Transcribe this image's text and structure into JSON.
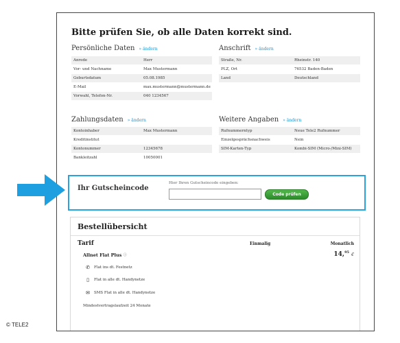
{
  "page_title": "Bitte prüfen Sie, ob alle Daten korrekt sind.",
  "edit_label": "» ändern",
  "personal": {
    "heading": "Persönliche Daten",
    "rows": [
      {
        "k": "Anrede",
        "v": "Herr"
      },
      {
        "k": "Vor- und Nachname",
        "v": "Max Mustermann"
      },
      {
        "k": "Geburtsdatum",
        "v": "05.08.1985"
      },
      {
        "k": "E-Mail",
        "v": "max.mustermann@mustermann.de"
      },
      {
        "k": "Vorwahl, Telefon-Nr.",
        "v": "040 1234567"
      }
    ]
  },
  "address": {
    "heading": "Anschrift",
    "rows": [
      {
        "k": "Straße, Nr.",
        "v": "Rheinstr. 140"
      },
      {
        "k": "PLZ, Ort",
        "v": "76532 Baden-Baden"
      },
      {
        "k": "Land",
        "v": "Deutschland"
      }
    ]
  },
  "payment": {
    "heading": "Zahlungsdaten",
    "rows": [
      {
        "k": "Kontoinhaber",
        "v": "Max Mustermann"
      },
      {
        "k": "Kreditinstitut",
        "v": ""
      },
      {
        "k": "Kontonummer",
        "v": "12345678"
      },
      {
        "k": "Bankleitzahl",
        "v": "10050001"
      }
    ]
  },
  "further": {
    "heading": "Weitere Angaben",
    "rows": [
      {
        "k": "Rufnummerntyp",
        "v": "Neue Tele2 Rufnummer"
      },
      {
        "k": "Einzelgesprächsnachweis",
        "v": "Nein"
      },
      {
        "k": "SIM-Karten-Typ",
        "v": "Kombi-SIM (Micro-/Mini-SIM)"
      }
    ]
  },
  "voucher": {
    "heading": "Ihr Gutscheincode",
    "label": "Hier Ihren Gutscheincode eingeben:",
    "value": "",
    "button": "Code prüfen"
  },
  "order": {
    "heading": "Bestellübersicht",
    "tarif_heading": "Tarif",
    "col_once": "Einmalig",
    "col_monthly": "Monatlich",
    "plan_name": "Allnet Flat Plus",
    "plan_info": "ⓘ",
    "price_main": "14,",
    "price_cents": "95",
    "price_currency": "€",
    "features": [
      {
        "icon": "phone-icon",
        "glyph": "✆",
        "text": "Flat ins dt. Festnetz"
      },
      {
        "icon": "mobile-icon",
        "glyph": "▯",
        "text": "Flat in alle dt. Handynetze"
      },
      {
        "icon": "mail-icon",
        "glyph": "✉",
        "text": "SMS Flat in alle dt. Handynetze"
      }
    ],
    "min_term": "Mindestvertragslaufzeit 24 Monate"
  },
  "copyright": "© TELE2",
  "colors": {
    "accent": "#29a3dc",
    "button": "#3a9e36",
    "link": "#1f8fc9"
  }
}
